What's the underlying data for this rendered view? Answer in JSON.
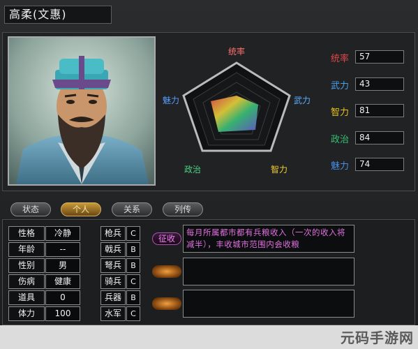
{
  "character": {
    "name": "高柔(文惠)"
  },
  "radar_labels": {
    "top": "统率",
    "right": "武力",
    "bottom_right": "智力",
    "bottom_left": "政治",
    "left": "魅力"
  },
  "stats": [
    {
      "label": "统率",
      "value": "57",
      "color": "#e04848"
    },
    {
      "label": "武力",
      "value": "43",
      "color": "#4aa0e8"
    },
    {
      "label": "智力",
      "value": "81",
      "color": "#e8c21c"
    },
    {
      "label": "政治",
      "value": "84",
      "color": "#38c070"
    },
    {
      "label": "魅力",
      "value": "74",
      "color": "#4a8ce8"
    }
  ],
  "tabs": [
    {
      "label": "状态",
      "active": false
    },
    {
      "label": "个人",
      "active": true
    },
    {
      "label": "关系",
      "active": false
    },
    {
      "label": "列传",
      "active": false
    }
  ],
  "personal": [
    {
      "label": "性格",
      "value": "冷静"
    },
    {
      "label": "年龄",
      "value": "--"
    },
    {
      "label": "性别",
      "value": "男"
    },
    {
      "label": "伤病",
      "value": "健康"
    },
    {
      "label": "道具",
      "value": "0"
    },
    {
      "label": "体力",
      "value": "100"
    }
  ],
  "arms": [
    {
      "label": "枪兵",
      "grade": "C"
    },
    {
      "label": "戟兵",
      "grade": "B"
    },
    {
      "label": "弩兵",
      "grade": "B"
    },
    {
      "label": "骑兵",
      "grade": "C"
    },
    {
      "label": "兵器",
      "grade": "B"
    },
    {
      "label": "水军",
      "grade": "C"
    }
  ],
  "skills": [
    {
      "name": "征收",
      "description": "每月所属都市都有兵粮收入（一次的收入将减半），丰收城市范围内会收粮"
    },
    {
      "name": "",
      "description": ""
    },
    {
      "name": "",
      "description": ""
    }
  ],
  "watermark": "元码手游网"
}
